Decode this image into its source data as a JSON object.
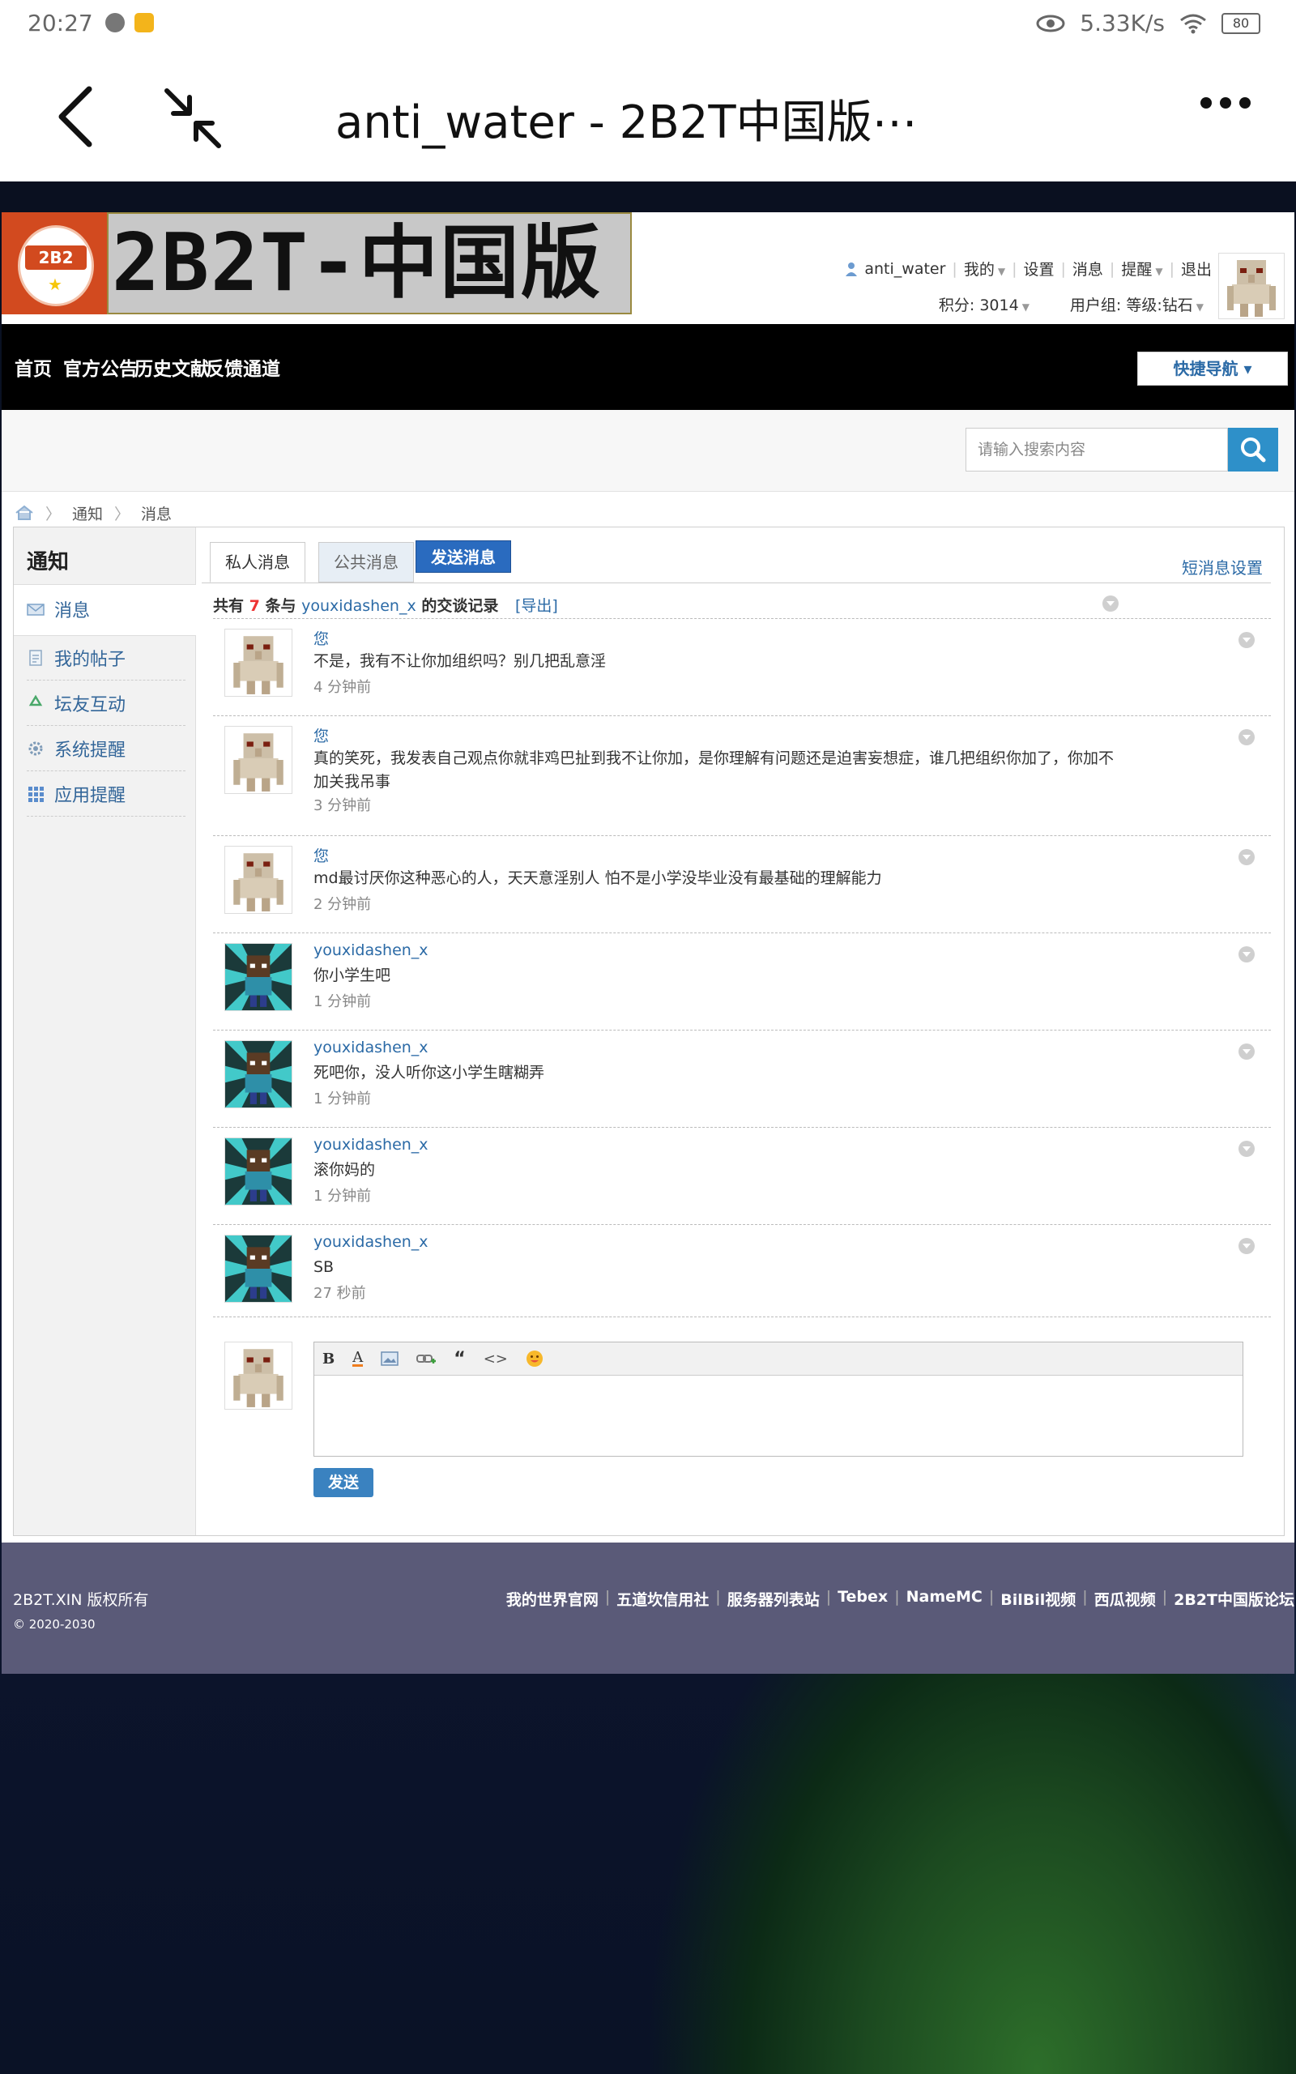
{
  "status_bar": {
    "time": "20:27",
    "network_speed": "5.33K/s",
    "battery": "80"
  },
  "browser": {
    "title": "anti_water - 2B2T中国版⋯"
  },
  "site": {
    "logo_badge": "2B2",
    "logo_text": "2B2T-中国版",
    "user_nav": {
      "username": "anti_water",
      "mine": "我的",
      "settings": "设置",
      "messages": "消息",
      "reminders": "提醒",
      "logout": "退出"
    },
    "stats": {
      "points": "积分: 3014",
      "group": "用户组: 等级:钻石"
    },
    "main_nav": [
      "首页",
      "官方公告",
      "历史文献",
      "反馈通道"
    ],
    "quick_nav": "快捷导航 ▾",
    "search": {
      "placeholder": "请输入搜索内容"
    },
    "breadcrumb": [
      "通知",
      "消息"
    ],
    "sidebar": {
      "title": "通知",
      "items": [
        "消息",
        "我的帖子",
        "坛友互动",
        "系统提醒",
        "应用提醒"
      ]
    },
    "tabs": {
      "private": "私人消息",
      "public": "公共消息",
      "send": "发送消息",
      "settings": "短消息设置"
    },
    "summary": {
      "prefix": "共有",
      "count": "7",
      "middle": "条与",
      "partner": "youxidashen_x",
      "suffix": "的交谈记录",
      "export": "[导出]"
    },
    "messages": [
      {
        "sender": "您",
        "text": "不是，我有不让你加组织吗？别几把乱意淫",
        "time": "4 分钟前",
        "avatar": "iron-golem"
      },
      {
        "sender": "您",
        "text": "真的笑死，我发表自己观点你就非鸡巴扯到我不让你加，是你理解有问题还是迫害妄想症，谁几把组织你加了，你加不加关我吊事",
        "time": "3 分钟前",
        "avatar": "iron-golem"
      },
      {
        "sender": "您",
        "text": "md最讨厌你这种恶心的人，天天意淫别人 怕不是小学没毕业没有最基础的理解能力",
        "time": "2 分钟前",
        "avatar": "iron-golem"
      },
      {
        "sender": "youxidashen_x",
        "text": "你小学生吧",
        "time": "1 分钟前",
        "avatar": "steve-burst"
      },
      {
        "sender": "youxidashen_x",
        "text": "死吧你，没人听你这小学生瞎糊弄",
        "time": "1 分钟前",
        "avatar": "steve-burst"
      },
      {
        "sender": "youxidashen_x",
        "text": "滚你妈的",
        "time": "1 分钟前",
        "avatar": "steve-burst"
      },
      {
        "sender": "youxidashen_x",
        "text": "SB",
        "time": "27 秒前",
        "avatar": "steve-burst"
      }
    ],
    "editor": {
      "toolbar": [
        "B",
        "A",
        "image-icon",
        "link-icon",
        "“",
        "<>",
        "emoji-icon"
      ],
      "send": "发送"
    },
    "footer": {
      "copyright": "2B2T.XIN 版权所有",
      "years": "© 2020-2030",
      "links": [
        "我的世界官网",
        "五道坎信用社",
        "服务器列表站",
        "Tebex",
        "NameMC",
        "BilBil视频",
        "西瓜视频",
        "2B2T中国版论坛"
      ]
    }
  }
}
